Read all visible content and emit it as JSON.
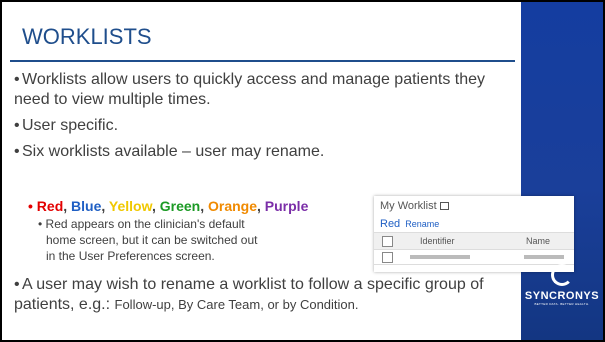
{
  "slide": {
    "title": "WORKLISTS",
    "bullets": [
      {
        "text": "Worklists allow users to quickly access and manage patients they need to view multiple times."
      },
      {
        "text": "User specific."
      },
      {
        "text": "Six worklists available – user may rename."
      }
    ],
    "colors": [
      {
        "label": "Red",
        "color": "#e30000"
      },
      {
        "label": "Blue",
        "color": "#1f5fc4"
      },
      {
        "label": "Yellow",
        "color": "#f0c800"
      },
      {
        "label": "Green",
        "color": "#1c9a25"
      },
      {
        "label": "Orange",
        "color": "#f08a00"
      },
      {
        "label": "Purple",
        "color": "#7b2ea8"
      }
    ],
    "sub_bullet_lines": [
      "Red appears on the clinician's default",
      "home screen, but it can be switched out",
      "in the User Preferences screen."
    ],
    "last_bullet": {
      "text_main": "A user may wish to rename a worklist to follow a specific group of patients, e.g.: ",
      "text_small": "Follow-up, By Care Team, or by Condition."
    }
  },
  "worklist_panel": {
    "title": "My Worklist",
    "tab_label": "Red",
    "rename_label": "Rename",
    "columns": [
      "Identifier",
      "Name"
    ]
  },
  "logo": {
    "name": "SYNCRONYS",
    "tagline": "BETTER DATA. BETTER HEALTH."
  }
}
